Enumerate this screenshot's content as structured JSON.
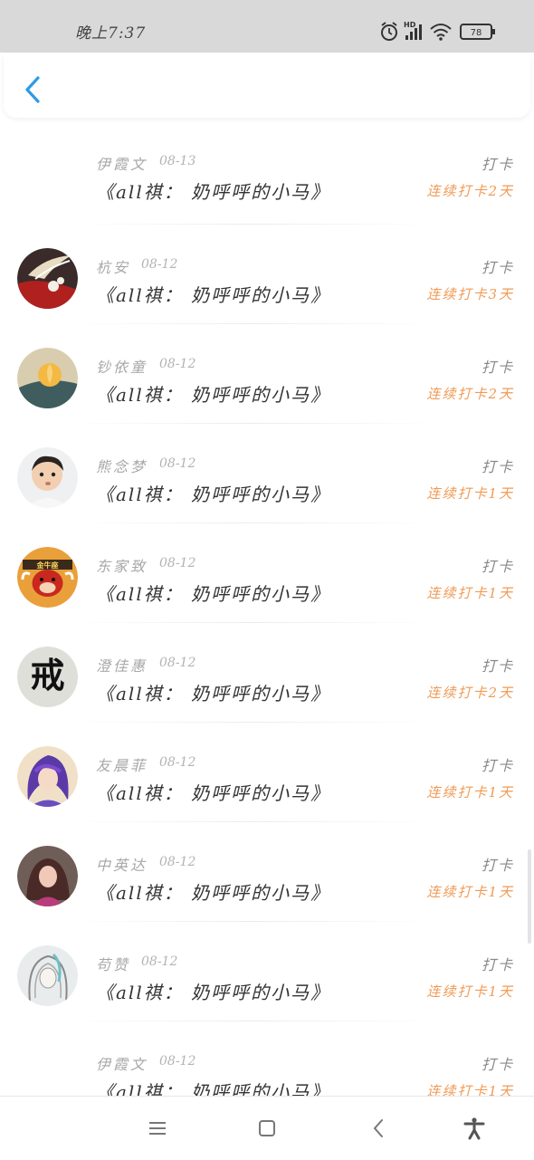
{
  "status_bar": {
    "time": "晚上7:37",
    "network": "HD",
    "battery": "78"
  },
  "header": {
    "back_icon": "chevron-left-icon",
    "accent_color": "#2d9be6"
  },
  "records": [
    {
      "name": "伊霞文",
      "date": "08-13",
      "title": "《all祺： 奶呼呼的小马》",
      "action": "打卡",
      "streak": "连续打卡2天",
      "avatar": "none"
    },
    {
      "name": "杭安",
      "date": "08-12",
      "title": "《all祺： 奶呼呼的小马》",
      "action": "打卡",
      "streak": "连续打卡3天",
      "avatar": "feather-brooch"
    },
    {
      "name": "钞依童",
      "date": "08-12",
      "title": "《all祺： 奶呼呼的小马》",
      "action": "打卡",
      "streak": "连续打卡2天",
      "avatar": "flower"
    },
    {
      "name": "熊念梦",
      "date": "08-12",
      "title": "《all祺： 奶呼呼的小马》",
      "action": "打卡",
      "streak": "连续打卡1天",
      "avatar": "child"
    },
    {
      "name": "东家致",
      "date": "08-12",
      "title": "《all祺： 奶呼呼的小马》",
      "action": "打卡",
      "streak": "连续打卡1天",
      "avatar": "cartoon-taurus",
      "avatar_text": "金牛座"
    },
    {
      "name": "澄佳惠",
      "date": "08-12",
      "title": "《all祺： 奶呼呼的小马》",
      "action": "打卡",
      "streak": "连续打卡2天",
      "avatar": "calligraphy",
      "avatar_text": "戒"
    },
    {
      "name": "友晨菲",
      "date": "08-12",
      "title": "《all祺： 奶呼呼的小马》",
      "action": "打卡",
      "streak": "连续打卡1天",
      "avatar": "anime-girl"
    },
    {
      "name": "中英达",
      "date": "08-12",
      "title": "《all祺： 奶呼呼的小马》",
      "action": "打卡",
      "streak": "连续打卡1天",
      "avatar": "girl-photo"
    },
    {
      "name": "苟赞",
      "date": "08-12",
      "title": "《all祺： 奶呼呼的小马》",
      "action": "打卡",
      "streak": "连续打卡1天",
      "avatar": "sketch"
    },
    {
      "name": "伊霞文",
      "date": "08-12",
      "title": "《all祺： 奶呼呼的小马》",
      "action": "打卡",
      "streak": "连续打卡1天",
      "avatar": "none"
    }
  ],
  "colors": {
    "streak": "#f09a55",
    "title": "#333333",
    "meta": "#a8a8a8"
  },
  "navbar": [
    "menu-icon",
    "home-square-icon",
    "back-icon",
    "accessibility-icon"
  ]
}
